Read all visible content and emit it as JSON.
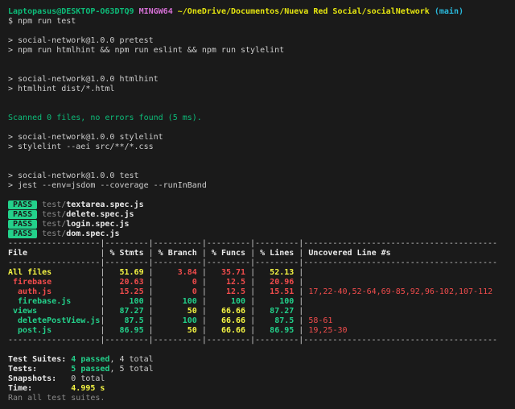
{
  "colors": {
    "background": "#1a1a1a",
    "fg": "#cccccc",
    "white": "#e9e9e9",
    "dim": "#8a8a8a",
    "green": "#0dbc79",
    "bgreen": "#23d18b",
    "red": "#f14c4c",
    "yellow": "#e5e510",
    "byellow": "#f5f543",
    "magenta": "#d670d6",
    "cyan": "#29b8db",
    "badgeText": "#1a1a1a"
  },
  "terminal": {
    "lines": [
      {
        "n": "prompt-line",
        "s": [
          {
            "t": "Laptopasus@DESKTOP-O63DTQ9",
            "c": "green",
            "b": 1,
            "n": "prompt-user-host"
          },
          {
            "t": " ",
            "c": "fg"
          },
          {
            "t": "MINGW64",
            "c": "magenta",
            "b": 1,
            "n": "prompt-platform"
          },
          {
            "t": " ",
            "c": "fg"
          },
          {
            "t": "~/OneDrive/Documentos/Nueva Red Social/socialNetwork",
            "c": "yellow",
            "b": 1,
            "n": "prompt-cwd"
          },
          {
            "t": " ",
            "c": "fg"
          },
          {
            "t": "(main)",
            "c": "cyan",
            "b": 1,
            "n": "prompt-git-branch"
          }
        ]
      },
      {
        "n": "command-input",
        "s": [
          {
            "t": "$ npm run test",
            "c": "fg",
            "n": "typed-command"
          }
        ]
      },
      {
        "n": "blank-line",
        "s": []
      },
      {
        "n": "npm-script-header-pretest",
        "s": [
          {
            "t": "> social-network@1.0.0 pretest",
            "c": "fg"
          }
        ]
      },
      {
        "n": "npm-script-command-pretest",
        "s": [
          {
            "t": "> npm run htmlhint && npm run eslint && npm run stylelint",
            "c": "fg"
          }
        ]
      },
      {
        "n": "blank-line",
        "s": []
      },
      {
        "n": "blank-line",
        "s": []
      },
      {
        "n": "npm-script-header-htmlhint",
        "s": [
          {
            "t": "> social-network@1.0.0 htmlhint",
            "c": "fg"
          }
        ]
      },
      {
        "n": "npm-script-command-htmlhint",
        "s": [
          {
            "t": "> htmlhint dist/*.html",
            "c": "fg"
          }
        ]
      },
      {
        "n": "blank-line",
        "s": []
      },
      {
        "n": "blank-line",
        "s": []
      },
      {
        "n": "htmlhint-result",
        "s": [
          {
            "t": "Scanned 0 files, no errors found (5 ms).",
            "c": "green"
          }
        ]
      },
      {
        "n": "blank-line",
        "s": []
      },
      {
        "n": "npm-script-header-stylelint",
        "s": [
          {
            "t": "> social-network@1.0.0 stylelint",
            "c": "fg"
          }
        ]
      },
      {
        "n": "npm-script-command-stylelint",
        "s": [
          {
            "t": "> stylelint --aei src/**/*.css",
            "c": "fg"
          }
        ]
      },
      {
        "n": "blank-line",
        "s": []
      },
      {
        "n": "blank-line",
        "s": []
      },
      {
        "n": "npm-script-header-test",
        "s": [
          {
            "t": "> social-network@1.0.0 test",
            "c": "fg"
          }
        ]
      },
      {
        "n": "npm-script-command-test",
        "s": [
          {
            "t": "> jest --env=jsdom --coverage --runInBand",
            "c": "fg"
          }
        ]
      },
      {
        "n": "blank-line",
        "s": []
      },
      {
        "n": "test-result-textarea",
        "s": [
          {
            "t": " PASS ",
            "c": "badgeText",
            "bg": "bgreen",
            "b": 1,
            "n": "pass-badge"
          },
          {
            "t": " ",
            "c": "fg"
          },
          {
            "t": "test/",
            "c": "dim",
            "n": "test-file-dir"
          },
          {
            "t": "textarea.spec.js",
            "c": "white",
            "b": 1,
            "n": "test-file-name"
          }
        ]
      },
      {
        "n": "test-result-delete",
        "s": [
          {
            "t": " PASS ",
            "c": "badgeText",
            "bg": "bgreen",
            "b": 1,
            "n": "pass-badge"
          },
          {
            "t": " ",
            "c": "fg"
          },
          {
            "t": "test/",
            "c": "dim",
            "n": "test-file-dir"
          },
          {
            "t": "delete.spec.js",
            "c": "white",
            "b": 1,
            "n": "test-file-name"
          }
        ]
      },
      {
        "n": "test-result-login",
        "s": [
          {
            "t": " PASS ",
            "c": "badgeText",
            "bg": "bgreen",
            "b": 1,
            "n": "pass-badge"
          },
          {
            "t": " ",
            "c": "fg"
          },
          {
            "t": "test/",
            "c": "dim",
            "n": "test-file-dir"
          },
          {
            "t": "login.spec.js",
            "c": "white",
            "b": 1,
            "n": "test-file-name"
          }
        ]
      },
      {
        "n": "test-result-dom",
        "s": [
          {
            "t": " PASS ",
            "c": "badgeText",
            "bg": "bgreen",
            "b": 1,
            "n": "pass-badge"
          },
          {
            "t": " ",
            "c": "fg"
          },
          {
            "t": "test/",
            "c": "dim",
            "n": "test-file-dir"
          },
          {
            "t": "dom.spec.js",
            "c": "white",
            "b": 1,
            "n": "test-file-name"
          }
        ]
      },
      {
        "n": "coverage-table-separator",
        "s": [
          {
            "t": "-------------------|---------|----------|---------|---------|----------------------------------------",
            "c": "fg"
          }
        ]
      },
      {
        "n": "coverage-table-header",
        "s": [
          {
            "t": "File               ",
            "c": "white",
            "b": 1
          },
          {
            "t": "|",
            "c": "fg"
          },
          {
            "t": " % Stmts ",
            "c": "white",
            "b": 1
          },
          {
            "t": "|",
            "c": "fg"
          },
          {
            "t": " % Branch ",
            "c": "white",
            "b": 1
          },
          {
            "t": "|",
            "c": "fg"
          },
          {
            "t": " % Funcs ",
            "c": "white",
            "b": 1
          },
          {
            "t": "|",
            "c": "fg"
          },
          {
            "t": " % Lines ",
            "c": "white",
            "b": 1
          },
          {
            "t": "|",
            "c": "fg"
          },
          {
            "t": " Uncovered Line #s",
            "c": "white",
            "b": 1
          }
        ]
      },
      {
        "n": "coverage-table-separator",
        "s": [
          {
            "t": "-------------------|---------|----------|---------|---------|----------------------------------------",
            "c": "fg"
          }
        ]
      },
      {
        "n": "coverage-row-all-files",
        "s": [
          {
            "t": "All files          ",
            "c": "byellow",
            "b": 1
          },
          {
            "t": "|",
            "c": "fg"
          },
          {
            "t": "   51.69 ",
            "c": "byellow",
            "b": 1
          },
          {
            "t": "|",
            "c": "fg"
          },
          {
            "t": "     3.84 ",
            "c": "red",
            "b": 1
          },
          {
            "t": "|",
            "c": "fg"
          },
          {
            "t": "   35.71 ",
            "c": "red",
            "b": 1
          },
          {
            "t": "|",
            "c": "fg"
          },
          {
            "t": "   52.13 ",
            "c": "byellow",
            "b": 1
          },
          {
            "t": "|",
            "c": "fg"
          }
        ]
      },
      {
        "n": "coverage-row-firebase",
        "s": [
          {
            "t": " firebase          ",
            "c": "red",
            "b": 1
          },
          {
            "t": "|",
            "c": "fg"
          },
          {
            "t": "   20.63 ",
            "c": "red",
            "b": 1
          },
          {
            "t": "|",
            "c": "fg"
          },
          {
            "t": "        0 ",
            "c": "red",
            "b": 1
          },
          {
            "t": "|",
            "c": "fg"
          },
          {
            "t": "    12.5 ",
            "c": "red",
            "b": 1
          },
          {
            "t": "|",
            "c": "fg"
          },
          {
            "t": "   20.96 ",
            "c": "red",
            "b": 1
          },
          {
            "t": "|",
            "c": "fg"
          }
        ]
      },
      {
        "n": "coverage-row-auth-js",
        "s": [
          {
            "t": "  auth.js          ",
            "c": "red",
            "b": 1
          },
          {
            "t": "|",
            "c": "fg"
          },
          {
            "t": "   15.25 ",
            "c": "red",
            "b": 1
          },
          {
            "t": "|",
            "c": "fg"
          },
          {
            "t": "        0 ",
            "c": "red",
            "b": 1
          },
          {
            "t": "|",
            "c": "fg"
          },
          {
            "t": "    12.5 ",
            "c": "red",
            "b": 1
          },
          {
            "t": "|",
            "c": "fg"
          },
          {
            "t": "   15.51 ",
            "c": "red",
            "b": 1
          },
          {
            "t": "|",
            "c": "fg"
          },
          {
            "t": " 17,22-40,52-64,69-85,92,96-102,107-112",
            "c": "red",
            "n": "uncovered-lines"
          }
        ]
      },
      {
        "n": "coverage-row-firebase-js",
        "s": [
          {
            "t": "  firebase.js      ",
            "c": "bgreen",
            "b": 1
          },
          {
            "t": "|",
            "c": "fg"
          },
          {
            "t": "     100 ",
            "c": "bgreen",
            "b": 1
          },
          {
            "t": "|",
            "c": "fg"
          },
          {
            "t": "      100 ",
            "c": "bgreen",
            "b": 1
          },
          {
            "t": "|",
            "c": "fg"
          },
          {
            "t": "     100 ",
            "c": "bgreen",
            "b": 1
          },
          {
            "t": "|",
            "c": "fg"
          },
          {
            "t": "     100 ",
            "c": "bgreen",
            "b": 1
          },
          {
            "t": "|",
            "c": "fg"
          }
        ]
      },
      {
        "n": "coverage-row-views",
        "s": [
          {
            "t": " views             ",
            "c": "bgreen",
            "b": 1
          },
          {
            "t": "|",
            "c": "fg"
          },
          {
            "t": "   87.27 ",
            "c": "bgreen",
            "b": 1
          },
          {
            "t": "|",
            "c": "fg"
          },
          {
            "t": "       50 ",
            "c": "byellow",
            "b": 1
          },
          {
            "t": "|",
            "c": "fg"
          },
          {
            "t": "   66.66 ",
            "c": "byellow",
            "b": 1
          },
          {
            "t": "|",
            "c": "fg"
          },
          {
            "t": "   87.27 ",
            "c": "bgreen",
            "b": 1
          },
          {
            "t": "|",
            "c": "fg"
          }
        ]
      },
      {
        "n": "coverage-row-delete-post-view-js",
        "s": [
          {
            "t": "  deletePostView.js",
            "c": "bgreen",
            "b": 1
          },
          {
            "t": "|",
            "c": "fg"
          },
          {
            "t": "    87.5 ",
            "c": "bgreen",
            "b": 1
          },
          {
            "t": "|",
            "c": "fg"
          },
          {
            "t": "      100 ",
            "c": "bgreen",
            "b": 1
          },
          {
            "t": "|",
            "c": "fg"
          },
          {
            "t": "   66.66 ",
            "c": "byellow",
            "b": 1
          },
          {
            "t": "|",
            "c": "fg"
          },
          {
            "t": "    87.5 ",
            "c": "bgreen",
            "b": 1
          },
          {
            "t": "|",
            "c": "fg"
          },
          {
            "t": " 58-61",
            "c": "red",
            "n": "uncovered-lines"
          }
        ]
      },
      {
        "n": "coverage-row-post-js",
        "s": [
          {
            "t": "  post.js          ",
            "c": "bgreen",
            "b": 1
          },
          {
            "t": "|",
            "c": "fg"
          },
          {
            "t": "   86.95 ",
            "c": "bgreen",
            "b": 1
          },
          {
            "t": "|",
            "c": "fg"
          },
          {
            "t": "       50 ",
            "c": "byellow",
            "b": 1
          },
          {
            "t": "|",
            "c": "fg"
          },
          {
            "t": "   66.66 ",
            "c": "byellow",
            "b": 1
          },
          {
            "t": "|",
            "c": "fg"
          },
          {
            "t": "   86.95 ",
            "c": "bgreen",
            "b": 1
          },
          {
            "t": "|",
            "c": "fg"
          },
          {
            "t": " 19,25-30",
            "c": "red",
            "n": "uncovered-lines"
          }
        ]
      },
      {
        "n": "coverage-table-separator",
        "s": [
          {
            "t": "-------------------|---------|----------|---------|---------|----------------------------------------",
            "c": "fg"
          }
        ]
      },
      {
        "n": "blank-line",
        "s": []
      },
      {
        "n": "summary-test-suites",
        "s": [
          {
            "t": "Test Suites: ",
            "c": "white",
            "b": 1,
            "n": "summary-label"
          },
          {
            "t": "4 passed",
            "c": "bgreen",
            "b": 1,
            "n": "summary-passed-count"
          },
          {
            "t": ", 4 total",
            "c": "fg",
            "n": "summary-total-count"
          }
        ]
      },
      {
        "n": "summary-tests",
        "s": [
          {
            "t": "Tests:       ",
            "c": "white",
            "b": 1,
            "n": "summary-label"
          },
          {
            "t": "5 passed",
            "c": "bgreen",
            "b": 1,
            "n": "summary-passed-count"
          },
          {
            "t": ", 5 total",
            "c": "fg",
            "n": "summary-total-count"
          }
        ]
      },
      {
        "n": "summary-snapshots",
        "s": [
          {
            "t": "Snapshots:   ",
            "c": "white",
            "b": 1,
            "n": "summary-label"
          },
          {
            "t": "0 total",
            "c": "fg",
            "n": "summary-total-count"
          }
        ]
      },
      {
        "n": "summary-time",
        "s": [
          {
            "t": "Time:        ",
            "c": "white",
            "b": 1,
            "n": "summary-label"
          },
          {
            "t": "4.995 s",
            "c": "byellow",
            "b": 1,
            "n": "summary-time-value"
          }
        ]
      },
      {
        "n": "summary-footer",
        "s": [
          {
            "t": "Ran all test suites.",
            "c": "dim"
          }
        ]
      }
    ]
  }
}
